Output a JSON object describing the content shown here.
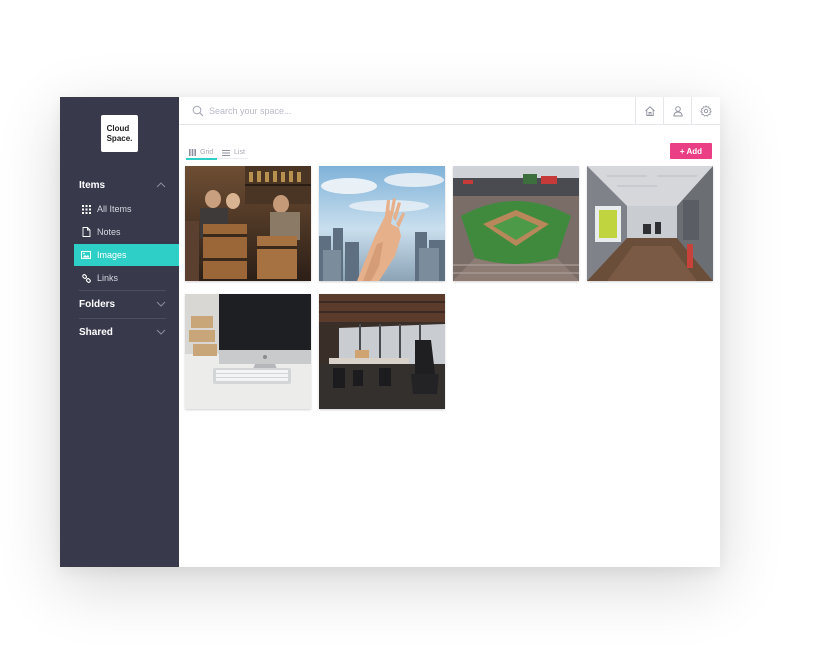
{
  "app": {
    "logo_text": "Cloud\nSpace."
  },
  "sidebar": {
    "sections": [
      {
        "label": "Items",
        "expanded": true
      },
      {
        "label": "Folders",
        "expanded": false
      },
      {
        "label": "Shared",
        "expanded": false
      }
    ],
    "items": [
      {
        "label": "All Items",
        "icon": "grid-icon",
        "active": false
      },
      {
        "label": "Notes",
        "icon": "document-icon",
        "active": false
      },
      {
        "label": "Images",
        "icon": "image-icon",
        "active": true
      },
      {
        "label": "Links",
        "icon": "link-icon",
        "active": false
      }
    ]
  },
  "search": {
    "placeholder": "Search your space...",
    "value": ""
  },
  "topbar": {
    "buttons": [
      "home-icon",
      "user-icon",
      "gear-icon"
    ]
  },
  "view": {
    "tabs": [
      {
        "label": "Grid",
        "icon": "grid-icon",
        "active": true
      },
      {
        "label": "List",
        "icon": "list-icon",
        "active": false
      }
    ]
  },
  "toolbar": {
    "add_label": "+ Add"
  },
  "images": [
    {
      "subject": "bar-with-barrels"
    },
    {
      "subject": "hand-over-city"
    },
    {
      "subject": "baseball-stadium"
    },
    {
      "subject": "office-hallway"
    },
    {
      "subject": "desk-with-imac"
    },
    {
      "subject": "open-office"
    }
  ],
  "colors": {
    "sidebar_bg": "#383a4c",
    "accent": "#2ecfc6",
    "add_button": "#ea3f85"
  }
}
